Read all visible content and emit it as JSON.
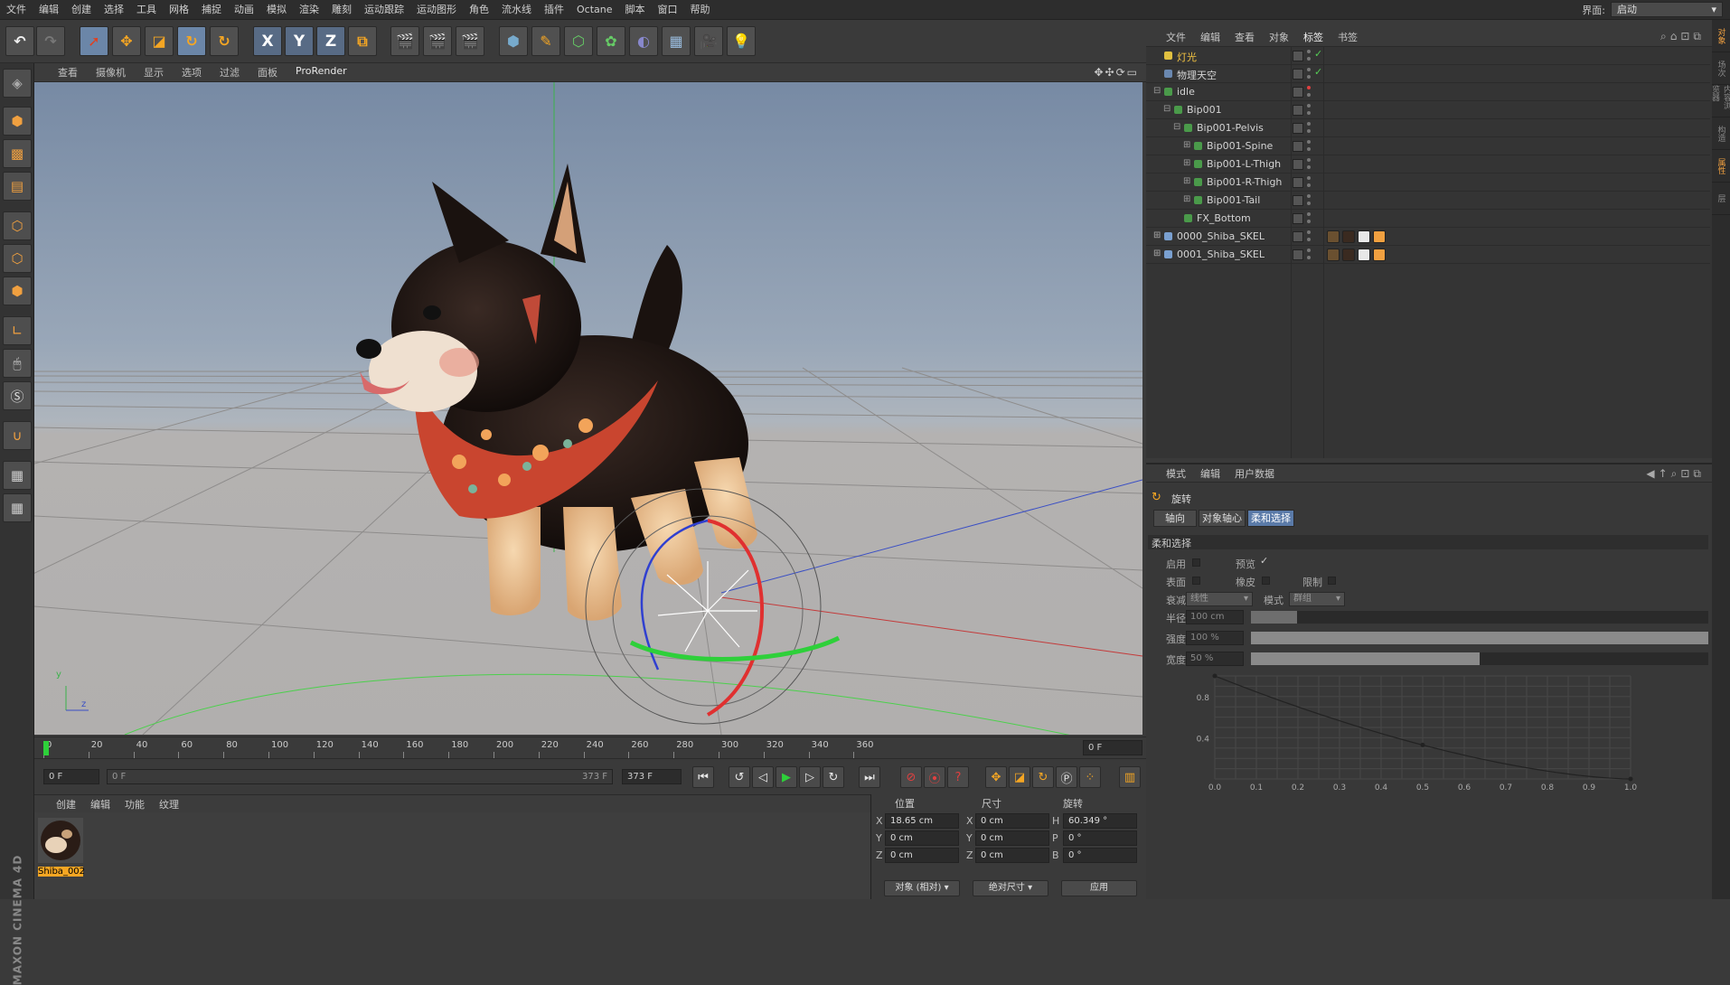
{
  "menu": [
    "文件",
    "编辑",
    "创建",
    "选择",
    "工具",
    "网格",
    "捕捉",
    "动画",
    "模拟",
    "渲染",
    "雕刻",
    "运动跟踪",
    "运动图形",
    "角色",
    "流水线",
    "插件",
    "Octane",
    "脚本",
    "窗口",
    "帮助"
  ],
  "layout": {
    "label": "界面:",
    "value": "启动"
  },
  "toolbar_axes": [
    "X",
    "Y",
    "Z"
  ],
  "viewport": {
    "menus": [
      "查看",
      "摄像机",
      "显示",
      "选项",
      "过滤",
      "面板",
      "ProRender"
    ],
    "axis_y": "y",
    "axis_z": "z"
  },
  "timeline": {
    "ticks": [
      "0",
      "20",
      "40",
      "60",
      "80",
      "100",
      "120",
      "140",
      "160",
      "180",
      "200",
      "220",
      "240",
      "260",
      "280",
      "300",
      "320",
      "340",
      "360"
    ],
    "current_frame": "0 F",
    "start_frame": "0 F",
    "range_left": "0 F",
    "range_right": "373 F",
    "end_frame": "373 F"
  },
  "material_panel": {
    "menus": [
      "创建",
      "编辑",
      "功能",
      "纹理"
    ],
    "material_name": "Shiba_002"
  },
  "coordinates": {
    "headers": [
      "位置",
      "尺寸",
      "旋转"
    ],
    "rows": [
      {
        "label": "X",
        "pos": "18.65 cm",
        "size_label": "X",
        "size": "0 cm",
        "rot_label": "H",
        "rot": "60.349 °"
      },
      {
        "label": "Y",
        "pos": "0 cm",
        "size_label": "Y",
        "size": "0 cm",
        "rot_label": "P",
        "rot": "0 °"
      },
      {
        "label": "Z",
        "pos": "0 cm",
        "size_label": "Z",
        "size": "0 cm",
        "rot_label": "B",
        "rot": "0 °"
      }
    ],
    "mode_dropdown": "对象 (相对)",
    "size_dropdown": "绝对尺寸",
    "apply_button": "应用"
  },
  "object_manager": {
    "menus": [
      "文件",
      "编辑",
      "查看",
      "对象",
      "标签",
      "书签"
    ],
    "objects": [
      {
        "name": "灯光",
        "indent": 0,
        "color": "#e0c040",
        "highlight": true
      },
      {
        "name": "物理天空",
        "indent": 0,
        "color": "#6a88b0"
      },
      {
        "name": "idle",
        "indent": 0,
        "color": "#4a9a4a"
      },
      {
        "name": "Bip001",
        "indent": 1,
        "color": "#4a9a4a"
      },
      {
        "name": "Bip001-Pelvis",
        "indent": 2,
        "color": "#4a9a4a"
      },
      {
        "name": "Bip001-Spine",
        "indent": 3,
        "color": "#4a9a4a"
      },
      {
        "name": "Bip001-L-Thigh",
        "indent": 3,
        "color": "#4a9a4a"
      },
      {
        "name": "Bip001-R-Thigh",
        "indent": 3,
        "color": "#4a9a4a"
      },
      {
        "name": "Bip001-Tail",
        "indent": 3,
        "color": "#4a9a4a"
      },
      {
        "name": "FX_Bottom",
        "indent": 2,
        "color": "#4a9a4a"
      },
      {
        "name": "0000_Shiba_SKEL",
        "indent": 0,
        "color": "#7aa0d0"
      },
      {
        "name": "0001_Shiba_SKEL",
        "indent": 0,
        "color": "#7aa0d0"
      }
    ]
  },
  "attributes": {
    "menus": [
      "模式",
      "编辑",
      "用户数据"
    ],
    "tool_name": "旋转",
    "tabs": [
      "轴向",
      "对象轴心",
      "柔和选择"
    ],
    "section": "柔和选择",
    "labels": {
      "enable": "启用",
      "preview": "预览",
      "surface": "表面",
      "rubber": "橡皮",
      "restrict": "限制",
      "falloff": "衰减",
      "mode": "模式",
      "radius": "半径",
      "strength": "强度",
      "width": "宽度"
    },
    "falloff_value": "线性",
    "mode_value": "群组",
    "radius_value": "100 cm",
    "strength_value": "100 %",
    "width_value": "50 %",
    "strength_fill": 1.0,
    "width_fill": 0.5,
    "graph_y_labels": [
      "0.8",
      "0.4"
    ],
    "graph_x_labels": [
      "0.0",
      "0.1",
      "0.2",
      "0.3",
      "0.4",
      "0.5",
      "0.6",
      "0.7",
      "0.8",
      "0.9",
      "1.0"
    ]
  },
  "right_tabs": [
    "对象",
    "场次",
    "内容浏览器",
    "构造",
    "属性",
    "层"
  ]
}
